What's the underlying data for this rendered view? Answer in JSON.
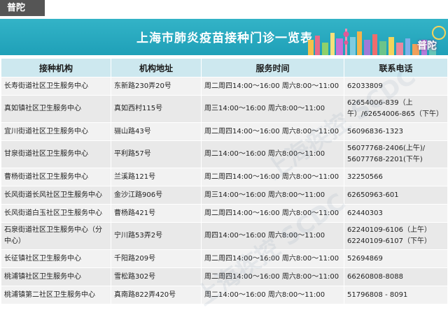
{
  "district_tag": "普陀",
  "banner": {
    "title": "上海市肺炎疫苗接种门诊一览表",
    "district": "普陀"
  },
  "watermark": "上海疾控 SCDC",
  "colors": {
    "banner": "#26a6bd",
    "header": "#cde8ef",
    "row_light": "#f2f2f2",
    "row_dark": "#e9e9e9",
    "tag": "#555555"
  },
  "table": {
    "headers": [
      "接种机构",
      "机构地址",
      "服务时间",
      "联系电话"
    ],
    "rows": [
      {
        "org": "长寿街道社区卫生服务中心",
        "addr": "东新路230弄20号",
        "time": "周二周四14:00～16:00 周六8:00～11:00",
        "phone": "62033809"
      },
      {
        "org": "真如镇社区卫生服务中心",
        "addr": "真如西村115号",
        "time": "周三14:00～16:00 周六8:00～11:00",
        "phone": "62654006-839（上午）/62654006-865（下午）"
      },
      {
        "org": "宜川街道社区卫生服务中心",
        "addr": "骊山路43号",
        "time": "周二周四14:00～16:00 周六8:00～11:00",
        "phone": "56096836-1323"
      },
      {
        "org": "甘泉街道社区卫生服务中心",
        "addr": "平利路57号",
        "time": "周二14:00～16:00 周六8:00～11:00",
        "phone": "56077768-2406(上午)/ 56077768-2201(下午)"
      },
      {
        "org": "曹杨街道社区卫生服务中心",
        "addr": "兰溪路121号",
        "time": "周二周四14:00～16:00 周六8:00～11:00",
        "phone": "32250566"
      },
      {
        "org": "长风街道长风社区卫生服务中心",
        "addr": "金沙江路906号",
        "time": "周三14:00～16:00 周六8:00～11:00",
        "phone": "62650963-601"
      },
      {
        "org": "长风街道白玉社区卫生服务中心",
        "addr": "曹杨路421号",
        "time": "周二周四14:00～16:00 周六8:00～11:00",
        "phone": "62440303"
      },
      {
        "org": "石泉街道社区卫生服务中心（分中心）",
        "addr": "宁川路53弄2号",
        "time": "周四14:00～16:00 周六8:00～11:00",
        "phone": "62240109-6106（上午） 62240109-6107（下午）"
      },
      {
        "org": "长征镇社区卫生服务中心",
        "addr": "千阳路209号",
        "time": "周二周四14:00～16:00 周六8:00～11:00",
        "phone": "52694869"
      },
      {
        "org": "桃浦镇社区卫生服务中心",
        "addr": "雪松路302号",
        "time": "周二周四14:00～16:00 周六8:00～11:00",
        "phone": "66260808-8088"
      },
      {
        "org": "桃浦镇第二社区卫生服务中心",
        "addr": "真南路822弄420号",
        "time": "周二14:00～16:00 周六8:00～11:00",
        "phone": "51796808 - 8091"
      }
    ]
  }
}
